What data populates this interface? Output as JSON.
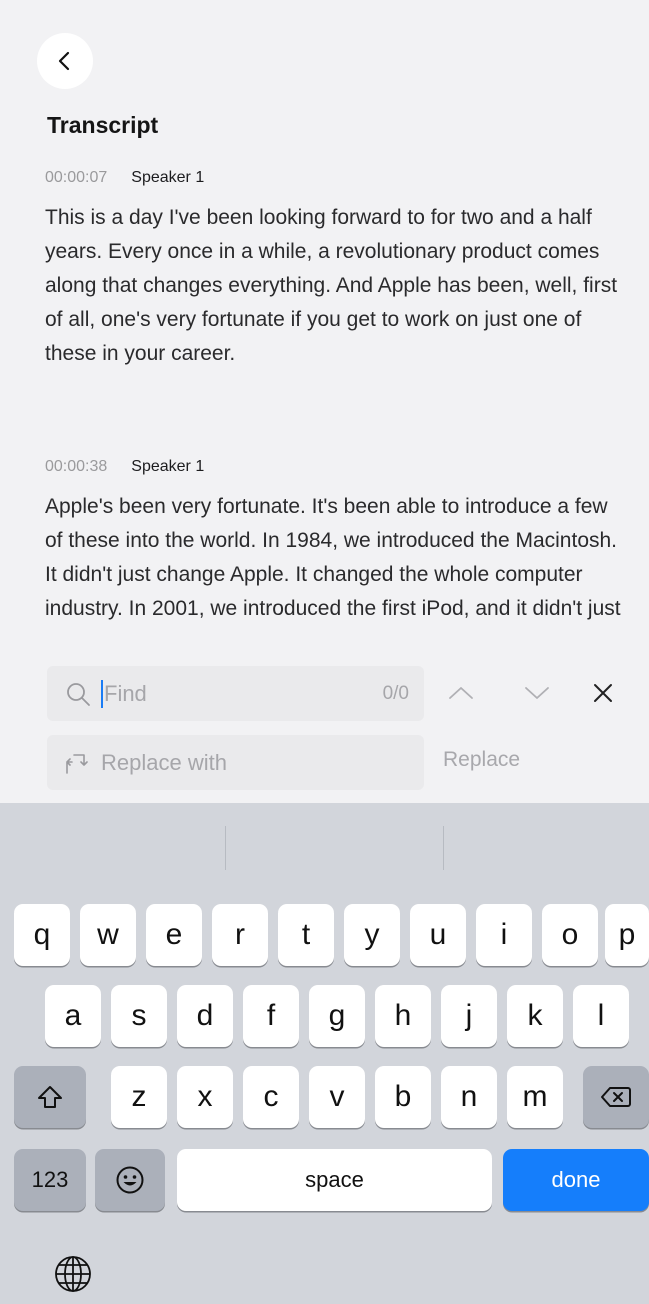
{
  "header": {
    "title": "Transcript"
  },
  "segments": [
    {
      "time": "00:00:07",
      "speaker": "Speaker 1",
      "text": "This is a day I've been looking forward to for two and a half years. Every once in a while, a revolutionary product comes along that changes everything. And Apple has been, well, first of all, one's very fortunate if you get to work on just one of these in your career."
    },
    {
      "time": "00:00:38",
      "speaker": "Speaker 1",
      "text": "Apple's been very fortunate. It's been able to introduce a few of these into the world. In 1984, we introduced the Macintosh. It didn't just change Apple. It changed the whole computer industry. In 2001, we introduced the first iPod, and it didn't just"
    }
  ],
  "find": {
    "placeholder": "Find",
    "value": "",
    "count": "0/0"
  },
  "replace": {
    "placeholder": "Replace with",
    "button": "Replace"
  },
  "keyboard": {
    "row1": [
      "q",
      "w",
      "e",
      "r",
      "t",
      "y",
      "u",
      "i",
      "o",
      "p"
    ],
    "row2": [
      "a",
      "s",
      "d",
      "f",
      "g",
      "h",
      "j",
      "k",
      "l"
    ],
    "row3": [
      "z",
      "x",
      "c",
      "v",
      "b",
      "n",
      "m"
    ],
    "numbers": "123",
    "space": "space",
    "done": "done"
  },
  "colors": {
    "accent": "#157efb",
    "background": "#f2f2f4",
    "keyboard": "#d2d5db"
  }
}
